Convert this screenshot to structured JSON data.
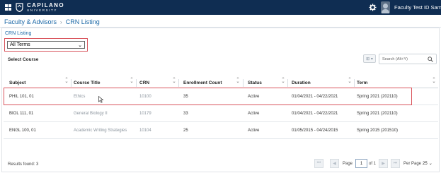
{
  "topbar": {
    "logo_name": "CAPILANO",
    "logo_sub": "UNIVERSITY",
    "user_name": "Faculty Test ID Sample",
    "bg_color": "#0f2d52"
  },
  "breadcrumb": {
    "items": [
      "Faculty & Advisors",
      "CRN Listing"
    ],
    "separator": "›"
  },
  "panel": {
    "title": "CRN Listing",
    "term_select": {
      "selected": "All Terms",
      "chevron": "⌄"
    },
    "section_label": "Select Course",
    "search": {
      "placeholder": "Search (Alt+Y)",
      "filter_glyph": "⊞ ▾"
    }
  },
  "table": {
    "columns": [
      "Subject",
      "Course Title",
      "CRN",
      "Enrollment Count",
      "Status",
      "Duration",
      "Term"
    ],
    "rows": [
      {
        "subject": "PHIL 101, 01",
        "course_title": "Ethics",
        "crn": "10100",
        "enrollment": "35",
        "status": "Active",
        "duration": "01/04/2021 - 04/22/2021",
        "term": "Spring 2021 (202110)"
      },
      {
        "subject": "BIOL 111, 01",
        "course_title": "General Biology II",
        "crn": "10179",
        "enrollment": "33",
        "status": "Active",
        "duration": "01/04/2021 - 04/22/2021",
        "term": "Spring 2021 (202110)"
      },
      {
        "subject": "ENGL 100, 01",
        "course_title": "Academic Writing Strategies",
        "crn": "10104",
        "enrollment": "25",
        "status": "Active",
        "duration": "01/05/2015 - 04/24/2015",
        "term": "Spring 2015 (201510)"
      }
    ]
  },
  "footer": {
    "results": "Results found: 3",
    "page_label": "Page",
    "page_value": "1",
    "of_label": "of 1",
    "per_page_label": "Per Page",
    "per_page_value": "25"
  },
  "colors": {
    "accent": "#1a67a6",
    "highlight": "#d9545c"
  }
}
